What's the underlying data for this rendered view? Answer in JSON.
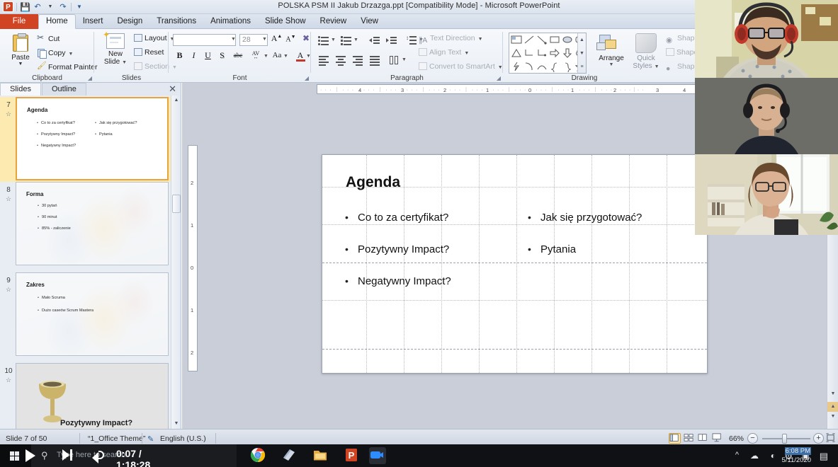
{
  "window": {
    "title": "POLSKA PSM II Jakub Drzazga.ppt [Compatibility Mode]  -  Microsoft PowerPoint",
    "app_logo": "P"
  },
  "quick_access": {
    "save_icon": "save-icon",
    "undo_icon": "undo-icon",
    "redo_icon": "redo-icon",
    "customize_icon": "customize-icon"
  },
  "ribbon": {
    "tabs": [
      {
        "label": "File",
        "id": "file"
      },
      {
        "label": "Home",
        "id": "home"
      },
      {
        "label": "Insert",
        "id": "insert"
      },
      {
        "label": "Design",
        "id": "design"
      },
      {
        "label": "Transitions",
        "id": "transitions"
      },
      {
        "label": "Animations",
        "id": "animations"
      },
      {
        "label": "Slide Show",
        "id": "slide-show"
      },
      {
        "label": "Review",
        "id": "review"
      },
      {
        "label": "View",
        "id": "view"
      }
    ],
    "active_tab": "Home",
    "clipboard": {
      "group_label": "Clipboard",
      "paste": "Paste",
      "cut": "Cut",
      "copy": "Copy",
      "format_painter": "Format Painter"
    },
    "slides": {
      "group_label": "Slides",
      "new_slide_line1": "New",
      "new_slide_line2": "Slide",
      "layout": "Layout",
      "reset": "Reset",
      "section": "Section"
    },
    "font": {
      "group_label": "Font",
      "font_name": "",
      "font_size": "28",
      "grow_font": "A",
      "shrink_font": "A",
      "clear_formatting": "clear-formatting-icon",
      "bold": "B",
      "italic": "I",
      "underline": "U",
      "shadow": "S",
      "strikethrough": "abc",
      "character_spacing": "AV",
      "change_case": "Aa",
      "font_color": "A"
    },
    "paragraph": {
      "group_label": "Paragraph",
      "text_direction": "Text Direction",
      "align_text": "Align Text",
      "convert_to_smartart": "Convert to SmartArt"
    },
    "drawing": {
      "group_label": "Drawing",
      "arrange": "Arrange",
      "quick_styles_line1": "Quick",
      "quick_styles_line2": "Styles",
      "shape_fill": "Shape Fill",
      "shape_outline": "Shape Outline",
      "shape_effects": "Shape Effects"
    }
  },
  "slide_panel": {
    "tabs": [
      {
        "label": "Slides"
      },
      {
        "label": "Outline"
      }
    ],
    "active_tab": "Slides",
    "close_label": "✕",
    "thumbnails": [
      {
        "number": "7",
        "selected": true,
        "title": "Agenda",
        "bullets_left": [
          "Co to za certyfikat?",
          "Pozytywny Impact?",
          "Negatywny Impact?"
        ],
        "bullets_right": [
          "Jak się przygotować?",
          "Pytania"
        ],
        "has_background_image": false
      },
      {
        "number": "8",
        "selected": false,
        "title": "Forma",
        "bullets_left": [
          "30 pytań",
          "90 minut",
          "85% - zaliczenie"
        ],
        "bullets_right": [],
        "has_background_image": true
      },
      {
        "number": "9",
        "selected": false,
        "title": "Zakres",
        "bullets_left": [
          "Mało Scruma",
          "Dużo caseów Scrum Mastera"
        ],
        "bullets_right": [],
        "has_background_image": true
      },
      {
        "number": "10",
        "selected": false,
        "title": "Pozytywny Impact?",
        "bullets_left": [],
        "bullets_right": [],
        "has_background_image": false,
        "has_goblet_image": true
      }
    ]
  },
  "slide": {
    "title": "Agenda",
    "bullets_left": [
      "Co to za certyfikat?",
      "Pozytywny Impact?",
      "Negatywny Impact?"
    ],
    "bullets_right": [
      "Jak się przygotować?",
      "Pytania"
    ],
    "bullet_glyph": "•"
  },
  "ruler": {
    "horizontal_ticks": [
      "4",
      "3",
      "2",
      "1",
      "0",
      "1",
      "2",
      "3",
      "4"
    ],
    "vertical_ticks": [
      "2",
      "1",
      "0",
      "1",
      "2"
    ]
  },
  "status_bar": {
    "slide_counter": "Slide 7 of 50",
    "theme": "“1_Office Theme”",
    "spell_icon": "spell-check-icon",
    "language": "English (U.S.)",
    "views": [
      "normal-view",
      "slide-sorter-view",
      "reading-view",
      "slide-show-view"
    ],
    "active_view": "normal-view",
    "zoom_level": "66%",
    "zoom_out": "−",
    "zoom_in": "+",
    "fit_to_window": "fit-slide-icon"
  },
  "video_call": {
    "participants": [
      {
        "name": "participant-1"
      },
      {
        "name": "participant-2"
      },
      {
        "name": "participant-3"
      }
    ]
  },
  "media_controls": {
    "play": "play-icon",
    "next": "next-icon",
    "volume": "volume-icon",
    "time": "0:07 / 1:18:28"
  },
  "taskbar": {
    "start": "windows-start-icon",
    "search_placeholder": "Type here to search",
    "apps": [
      {
        "name": "chrome-taskbar-icon"
      },
      {
        "name": "explorer-blue-taskbar-icon"
      },
      {
        "name": "folder-taskbar-icon"
      },
      {
        "name": "powerpoint-taskbar-icon"
      },
      {
        "name": "zoom-taskbar-icon",
        "active": true
      }
    ],
    "tray_arrow": "show-hidden-icons",
    "network_icon": "network-icon",
    "settings_icon": "settings-icon",
    "display_icon": "display-icon",
    "clock_time": "6:08 PM",
    "clock_date": "5/11/2020",
    "action_center": "action-center-icon"
  },
  "colors": {
    "accent": "#d04423",
    "selection": "#fdeab0",
    "ribbon_bg": "#f6f8fb"
  }
}
